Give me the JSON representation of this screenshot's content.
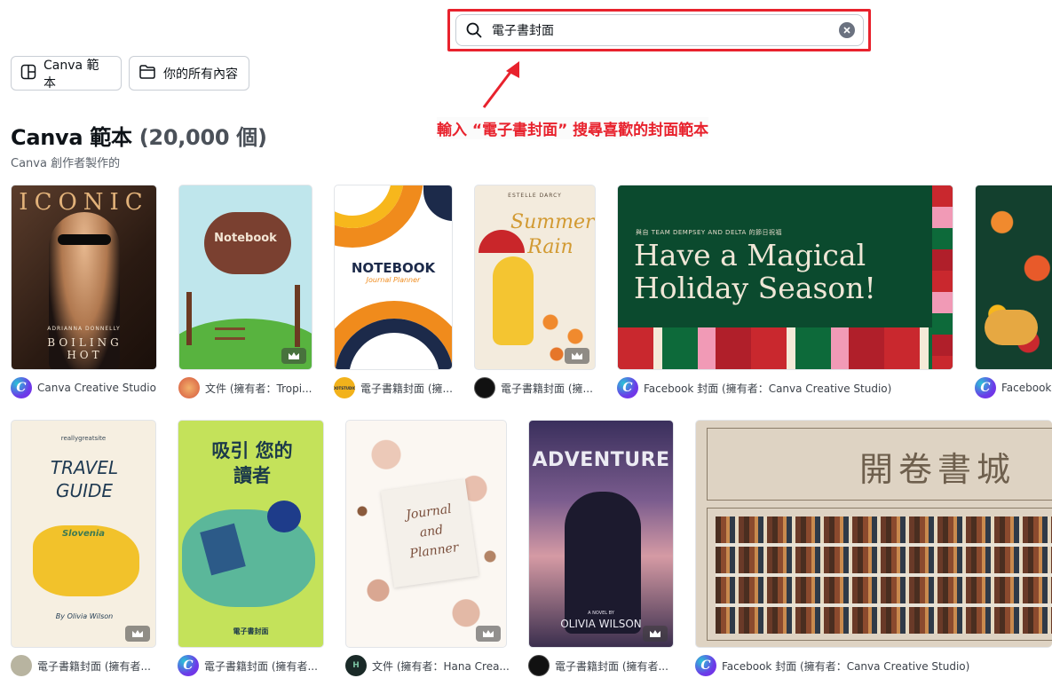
{
  "search": {
    "value": "電子書封面",
    "icon": "search-icon"
  },
  "filters": [
    {
      "label": "Canva 範本",
      "icon": "template-icon"
    },
    {
      "label": "你的所有內容",
      "icon": "folder-icon"
    }
  ],
  "annotation": {
    "text": "輸入 “電子書封面” 搜尋喜歡的封面範本",
    "color": "#e8222d"
  },
  "heading": {
    "title": "Canva 範本",
    "count": "(20,000 個)",
    "subtitle": "Canva 創作者製作的"
  },
  "cards_row1": [
    {
      "title_text": "ICONIC",
      "sub_text": "BOILING HOT",
      "author_small": "ADRIANNA DONNELLY",
      "caption": "Canva Creative Studio"
    },
    {
      "title_text": "Notebook",
      "caption": "文件 (擁有者：Tropi..."
    },
    {
      "title_text": "NOTEBOOK",
      "sub_text": "Journal Planner",
      "avatar_text": "DOTSTUDIO",
      "caption": "電子書籍封面 (擁..."
    },
    {
      "author_small": "ESTELLE DARCY",
      "title_text": "Summer Rain",
      "caption": "電子書籍封面 (擁..."
    },
    {
      "small_text": "與自 TEAM DEMPSEY AND DELTA 的節日祝福",
      "title_text": "Have a Magical Holiday Season!",
      "caption": "Facebook 封面 (擁有者：Canva Creative Studio)"
    },
    {
      "caption": "Facebook"
    }
  ],
  "cards_row2": [
    {
      "small_text": "reallygreatsite",
      "title_text": "TRAVEL GUIDE",
      "map_label": "Slovenia",
      "author_small": "By Olivia Wilson",
      "caption": "電子書籍封面 (擁有者..."
    },
    {
      "title_text": "吸引 您的讀者",
      "sub_text": "電子書封面",
      "caption": "電子書籍封面 (擁有者..."
    },
    {
      "title_text": "Journal and Planner",
      "avatar_text": "H",
      "caption": "文件 (擁有者：Hana Crea..."
    },
    {
      "title_text": "ADVENTURE",
      "small_text": "A NOVEL BY",
      "sub_text": "OLIVIA WILSON",
      "caption": "電子書籍封面 (擁有者..."
    },
    {
      "title_text": "開卷書城",
      "caption": "Facebook 封面 (擁有者：Canva Creative Studio)"
    }
  ]
}
